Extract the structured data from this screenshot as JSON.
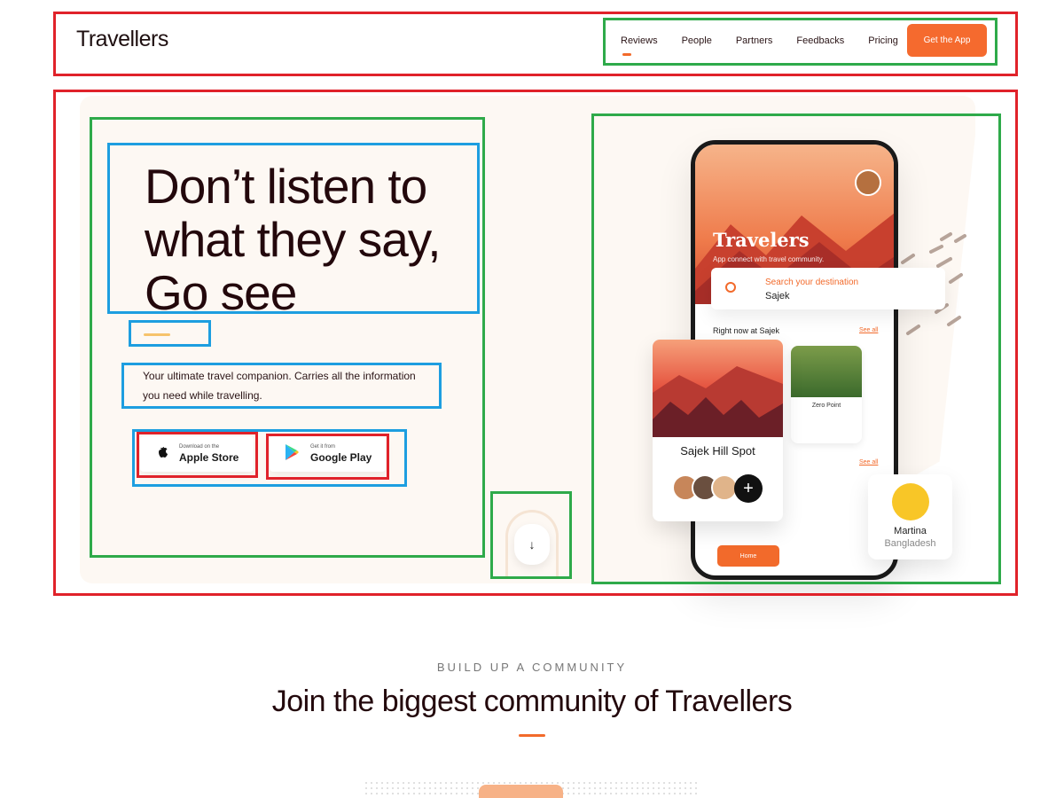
{
  "header": {
    "logo": "Travellers",
    "nav": [
      "Reviews",
      "People",
      "Partners",
      "Feedbacks",
      "Pricing"
    ],
    "active_nav": "Reviews",
    "cta": "Get the App"
  },
  "hero": {
    "headline_lines": [
      "Don’t listen to",
      "what they say,",
      "Go see"
    ],
    "subtext_lines": [
      "Your ultimate travel companion. Carries all the information",
      "you need while travelling."
    ],
    "apple": {
      "small": "Download on the",
      "big": "Apple Store"
    },
    "google": {
      "small": "Get it from",
      "big": "Google Play"
    }
  },
  "phone": {
    "title": "Travelers",
    "subtitle": "App connect with travel community.",
    "right_now": "Right now at Sajek",
    "see_all": "See all",
    "spot": "Zero Point",
    "home": "Home"
  },
  "search": {
    "placeholder": "Search your destination",
    "value": "Sajek"
  },
  "sajek_card": {
    "name": "Sajek Hill Spot"
  },
  "martina": {
    "name": "Martina",
    "location": "Bangladesh"
  },
  "community": {
    "kicker": "BUILD UP A COMMUNITY",
    "title": "Join the biggest community of Travellers"
  },
  "colors": {
    "accent": "#f26a2b",
    "annotation_red": "#e0222a",
    "annotation_green": "#2eaa4a",
    "annotation_blue": "#1d9ee0"
  }
}
